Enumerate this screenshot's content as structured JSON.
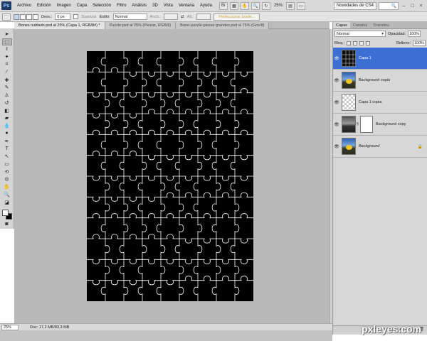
{
  "menubar": {
    "logo": "Ps",
    "items": [
      "Archivo",
      "Edición",
      "Imagen",
      "Capa",
      "Selección",
      "Filtro",
      "Análisis",
      "3D",
      "Vista",
      "Ventana",
      "Ayuda"
    ],
    "zoom": "25%",
    "workspace": "Novedades de CS4"
  },
  "options": {
    "feather_label": "Desv.:",
    "feather_value": "0 px",
    "antialias_label": "Suavizar",
    "style_label": "Estilo:",
    "style_value": "Normal",
    "width_label": "Anch.:",
    "height_label": "Alt.:",
    "refine_label": "Perfeccionar borde..."
  },
  "tabs": [
    "Bones nublado.psd al 25% (Capa 1, RGB/8#) *",
    "Puzzle.psd al 25% (Piezas, RGB/8)",
    "Bone-puzzle-piezas grandes.psd al 75% (Gris/8)"
  ],
  "status": {
    "zoom": "25%",
    "doc": "Doc: 17,2 MB/83,3 MB"
  },
  "layers_panel": {
    "tabs": [
      "Capas",
      "Canales",
      "Trazados"
    ],
    "blend_mode": "Normal",
    "opacity_label": "Opacidad:",
    "opacity_value": "100%",
    "lock_label": "Bloq.:",
    "fill_label": "Relleno:",
    "fill_value": "100%",
    "layers": [
      {
        "name": "Capa 1",
        "selected": true
      },
      {
        "name": "Background copia",
        "selected": false
      },
      {
        "name": "Capa 1 copia",
        "selected": false
      },
      {
        "name": "Background copy",
        "selected": false
      },
      {
        "name": "Background",
        "selected": false
      }
    ]
  },
  "watermark": "pxleyes.com"
}
